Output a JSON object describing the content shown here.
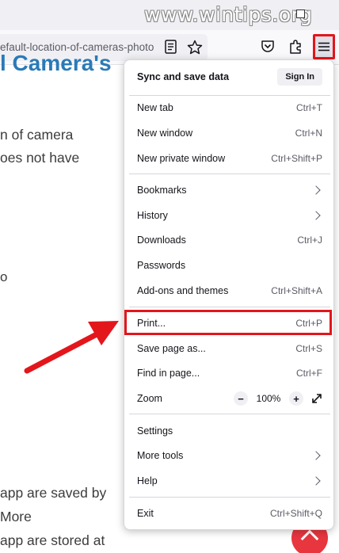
{
  "watermark": "www.wintips.org",
  "toolbar": {
    "url": "efault-location-of-cameras-photo",
    "icons": [
      "reader-view-icon",
      "bookmark-star-icon",
      "pocket-icon",
      "extensions-icon",
      "hamburger-menu-icon"
    ]
  },
  "page": {
    "heading": "l Camera's",
    "lines": [
      "n of camera",
      "oes not have",
      " app are saved by",
      " More",
      " app are stored at"
    ],
    "fragment": "o"
  },
  "menu": {
    "sync_label": "Sync and save data",
    "signin_label": "Sign In",
    "items": [
      {
        "label": "New tab",
        "shortcut": "Ctrl+T"
      },
      {
        "label": "New window",
        "shortcut": "Ctrl+N"
      },
      {
        "label": "New private window",
        "shortcut": "Ctrl+Shift+P"
      },
      {
        "label": "Bookmarks",
        "shortcut": ""
      },
      {
        "label": "History",
        "shortcut": ""
      },
      {
        "label": "Downloads",
        "shortcut": "Ctrl+J"
      },
      {
        "label": "Passwords",
        "shortcut": ""
      },
      {
        "label": "Add-ons and themes",
        "shortcut": "Ctrl+Shift+A"
      },
      {
        "label": "Print...",
        "shortcut": "Ctrl+P"
      },
      {
        "label": "Save page as...",
        "shortcut": "Ctrl+S"
      },
      {
        "label": "Find in page...",
        "shortcut": "Ctrl+F"
      },
      {
        "label": "Zoom",
        "shortcut": ""
      },
      {
        "label": "Settings",
        "shortcut": ""
      },
      {
        "label": "More tools",
        "shortcut": ""
      },
      {
        "label": "Help",
        "shortcut": ""
      },
      {
        "label": "Exit",
        "shortcut": "Ctrl+Shift+Q"
      }
    ],
    "zoom": {
      "minus": "−",
      "value": "100%",
      "plus": "+"
    }
  },
  "colors": {
    "highlight": "#e3161c",
    "heading": "#2a7ab8",
    "fab": "#e8363f"
  }
}
